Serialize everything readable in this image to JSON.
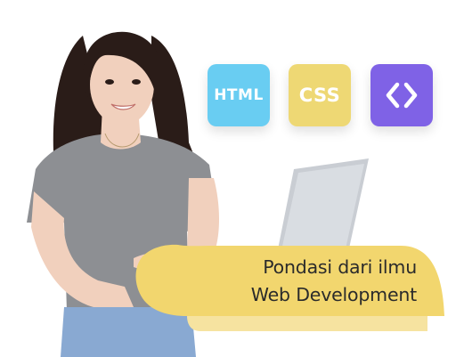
{
  "colors": {
    "html_tile": "#69cdf2",
    "css_tile": "#eed874",
    "code_tile": "#7f62e6",
    "banner": "#f2d66e",
    "banner_light": "#f6e3a0",
    "shirt": "#8d8f93",
    "hair": "#2a1c18",
    "skin": "#f1d0bd",
    "jeans": "#89a9d2",
    "laptop": "#c9cdd3"
  },
  "tiles": {
    "html_label": "HTML",
    "css_label": "CSS",
    "code_icon": "code-brackets-icon"
  },
  "banner": {
    "line1": "Pondasi dari ilmu",
    "line2": "Web Development"
  }
}
